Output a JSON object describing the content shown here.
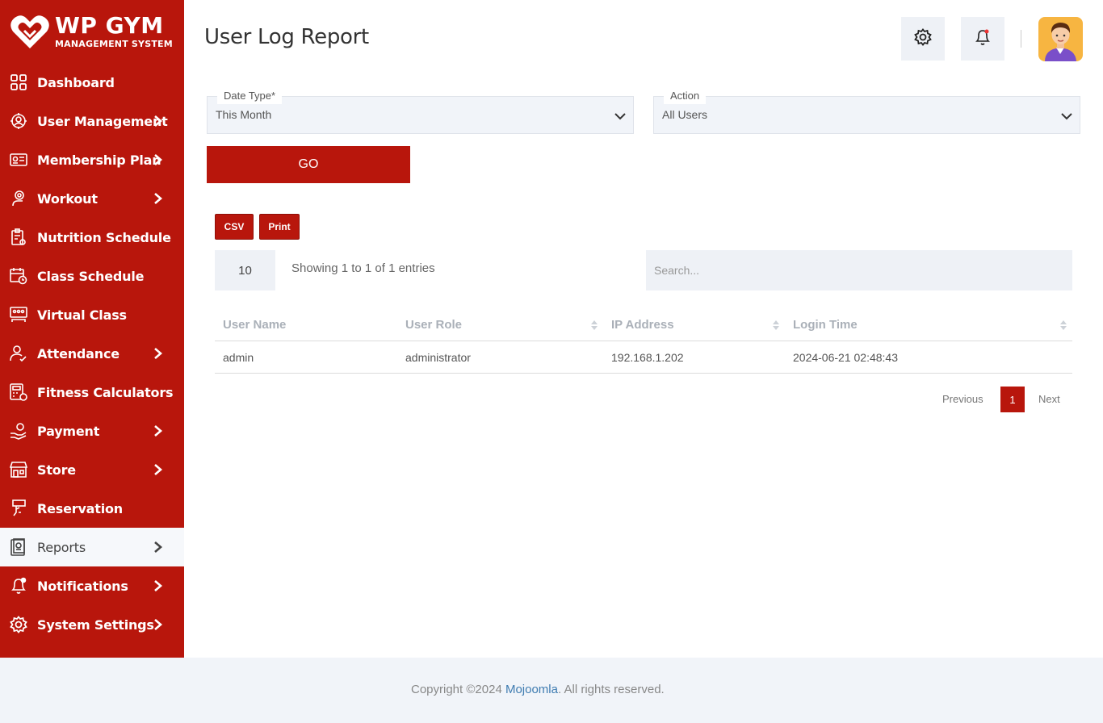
{
  "brand": {
    "title": "WP GYM",
    "subtitle": "MANAGEMENT SYSTEM",
    "accent": "#b8160c"
  },
  "sidebar": {
    "items": [
      {
        "label": "Dashboard",
        "icon": "dashboard-icon",
        "has_submenu": false
      },
      {
        "label": "User Management",
        "icon": "users-gear-icon",
        "has_submenu": true
      },
      {
        "label": "Membership Plan",
        "icon": "membership-card-icon",
        "has_submenu": true
      },
      {
        "label": "Workout",
        "icon": "workout-icon",
        "has_submenu": true
      },
      {
        "label": "Nutrition Schedule",
        "icon": "nutrition-clipboard-icon",
        "has_submenu": false
      },
      {
        "label": "Class Schedule",
        "icon": "calendar-clock-icon",
        "has_submenu": false
      },
      {
        "label": "Virtual Class",
        "icon": "virtual-class-icon",
        "has_submenu": false
      },
      {
        "label": "Attendance",
        "icon": "attendance-icon",
        "has_submenu": true
      },
      {
        "label": "Fitness Calculators",
        "icon": "calculator-icon",
        "has_submenu": false
      },
      {
        "label": "Payment",
        "icon": "payment-hand-icon",
        "has_submenu": true
      },
      {
        "label": "Store",
        "icon": "store-icon",
        "has_submenu": true
      },
      {
        "label": "Reservation",
        "icon": "reservation-icon",
        "has_submenu": false
      },
      {
        "label": "Reports",
        "icon": "report-icon",
        "has_submenu": true,
        "active": true
      },
      {
        "label": "Notifications",
        "icon": "bell-icon",
        "has_submenu": true
      },
      {
        "label": "System Settings",
        "icon": "settings-gear-icon",
        "has_submenu": true
      }
    ]
  },
  "header": {
    "title": "User Log Report"
  },
  "filters": {
    "date_type": {
      "label": "Date Type*",
      "value": "This Month"
    },
    "action": {
      "label": "Action",
      "value": "All Users"
    },
    "go_label": "GO"
  },
  "export": {
    "csv_label": "CSV",
    "print_label": "Print"
  },
  "table_controls": {
    "page_length": "10",
    "info": "Showing 1 to 1 of 1 entries",
    "search_placeholder": "Search..."
  },
  "table": {
    "columns": [
      "User Name",
      "User Role",
      "IP Address",
      "Login Time"
    ],
    "rows": [
      [
        "admin",
        "administrator",
        "192.168.1.202",
        "2024-06-21 02:48:43"
      ]
    ]
  },
  "pagination": {
    "previous": "Previous",
    "current": "1",
    "next": "Next"
  },
  "footer": {
    "prefix": "Copyright ©2024 ",
    "link": "Mojoomla",
    "suffix": ". All rights reserved."
  }
}
